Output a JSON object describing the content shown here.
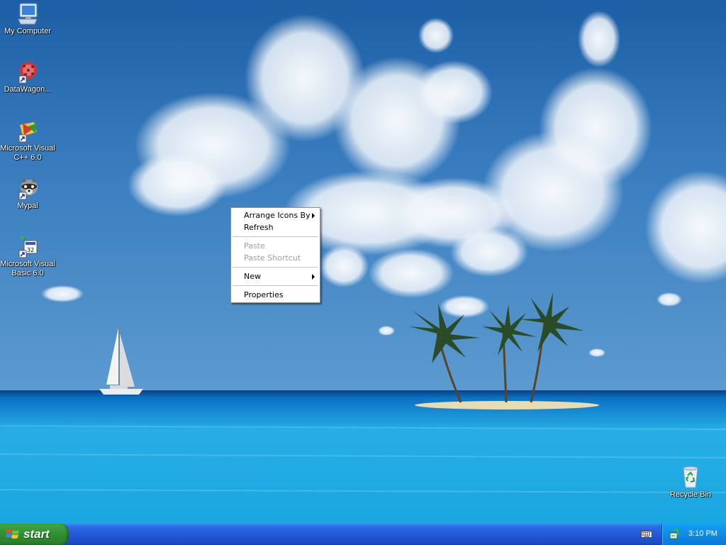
{
  "desktop": {
    "icons": [
      {
        "label": "My Computer",
        "icon": "computer-icon"
      },
      {
        "label": "DataWagon...",
        "icon": "datawagon-icon"
      },
      {
        "label": "Microsoft Visual C++ 6.0",
        "line1": "Microsoft Visual",
        "line2": "C++ 6.0",
        "icon": "visual-cpp-icon"
      },
      {
        "label": "Mypal",
        "icon": "mypal-raccoon-icon"
      },
      {
        "label": "Microsoft Visual Basic 6.0",
        "line1": "Microsoft Visual",
        "line2": "Basic 6.0",
        "icon": "visual-basic-icon"
      },
      {
        "label": "Recycle Bin",
        "icon": "recycle-bin-icon"
      }
    ]
  },
  "context_menu": {
    "items": [
      {
        "label": "Arrange Icons By",
        "submenu": true,
        "enabled": true
      },
      {
        "label": "Refresh",
        "enabled": true
      },
      {
        "label": "Paste",
        "enabled": false
      },
      {
        "label": "Paste Shortcut",
        "enabled": false
      },
      {
        "label": "New",
        "submenu": true,
        "enabled": true
      },
      {
        "label": "Properties",
        "enabled": true
      }
    ]
  },
  "taskbar": {
    "start_label": "start",
    "clock": "3:10 PM"
  },
  "colors": {
    "taskbar_blue": "#2459d8",
    "start_green": "#3c9f3c",
    "tray_blue": "#0f8fe9"
  }
}
